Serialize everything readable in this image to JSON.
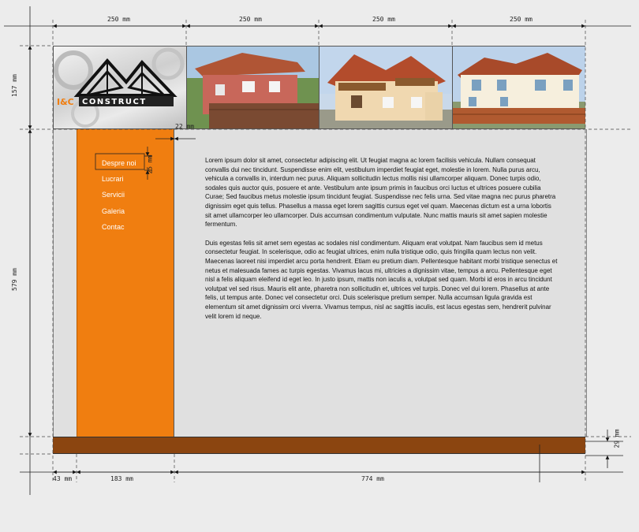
{
  "logo": {
    "prefix": "I&C",
    "name": "CONSTRUCT"
  },
  "nav": {
    "items": [
      {
        "label": "Despre noi"
      },
      {
        "label": "Lucrari"
      },
      {
        "label": "Servicii"
      },
      {
        "label": "Galeria"
      },
      {
        "label": "Contac"
      }
    ]
  },
  "content": {
    "paragraph1": "Lorem ipsum dolor sit amet, consectetur adipiscing elit. Ut feugiat magna ac lorem facilisis vehicula. Nullam consequat convallis dui nec tincidunt. Suspendisse enim elit, vestibulum imperdiet feugiat eget, molestie in lorem. Nulla purus arcu, vehicula a convallis in, interdum nec purus. Aliquam sollicitudin lectus mollis nisi ullamcorper aliquam. Donec turpis odio, sodales quis auctor quis, posuere et ante. Vestibulum ante ipsum primis in faucibus orci luctus et ultrices posuere cubilia Curae; Sed faucibus metus molestie ipsum tincidunt feugiat. Suspendisse nec felis urna. Sed vitae magna nec purus pharetra dignissim eget quis tellus. Phasellus a massa eget lorem sagittis cursus eget vel quam. Maecenas dictum est a urna lobortis sit amet ullamcorper leo ullamcorper. Duis accumsan condimentum vulputate. Nunc mattis mauris sit amet sapien molestie fermentum.",
    "paragraph2": "Duis egestas felis sit amet sem egestas ac sodales nisl condimentum. Aliquam erat volutpat. Nam faucibus sem id metus consectetur feugiat. In scelerisque, odio ac feugiat ultrices, enim nulla tristique odio, quis fringilla quam lectus non velit. Maecenas laoreet nisi imperdiet arcu porta hendrerit. Etiam eu pretium diam. Pellentesque habitant morbi tristique senectus et netus et malesuada fames ac turpis egestas. Vivamus lacus mi, ultricies a dignissim vitae, tempus a arcu. Pellentesque eget nisl a felis aliquam eleifend id eget leo. In justo ipsum, mattis non iaculis a, volutpat sed quam. Morbi id eros in arcu tincidunt volutpat vel sed risus. Mauris elit ante, pharetra non sollicitudin et, ultrices vel turpis. Donec vel dui lorem. Phasellus at ante felis, ut tempus ante. Donec vel consectetur orci. Duis scelerisque pretium semper. Nulla accumsan ligula gravida est elementum sit amet dignissim orci viverra. Vivamus tempus, nisl ac sagittis iaculis, est lacus egestas sem, hendrerit pulvinar velit lorem id neque."
  },
  "dimensions": {
    "banner_width_1": "250 mm",
    "banner_width_2": "250 mm",
    "banner_width_3": "250 mm",
    "banner_width_4": "250 mm",
    "banner_height": "157 mm",
    "content_height": "579 mm",
    "gap": "22 mm",
    "nav_item_height": "25 mm",
    "footer_height": "29 mm",
    "left_margin": "43 mm",
    "sidebar_width": "183 mm",
    "content_width": "774 mm"
  },
  "colors": {
    "sidebar": "#f07e10",
    "footer": "#8b4510",
    "content": "#e0e0e0",
    "page": "#ececec"
  }
}
